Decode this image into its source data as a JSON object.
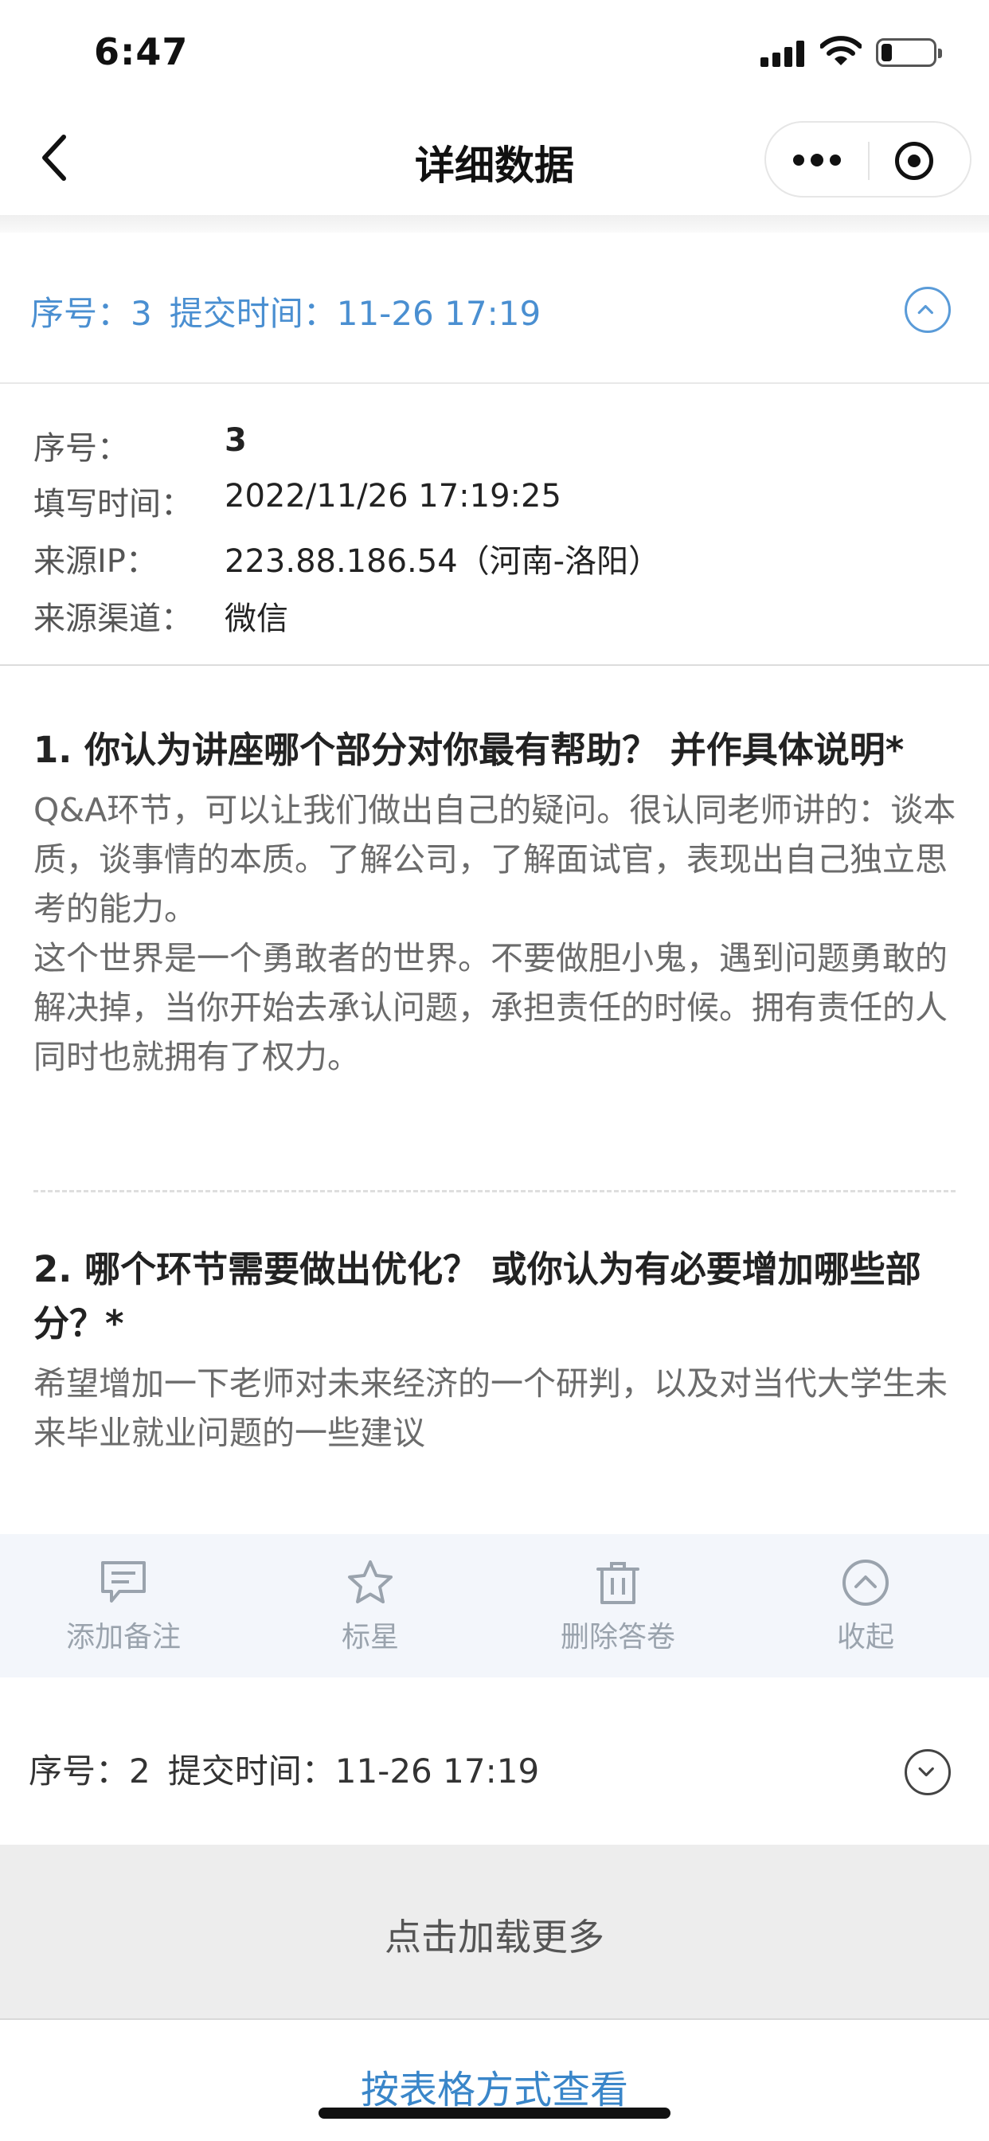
{
  "status_bar": {
    "time": "6:47",
    "battery_level": 0.2
  },
  "nav": {
    "title": "详细数据"
  },
  "current_record": {
    "header": {
      "seq": "序号：3",
      "submit_time": "提交时间：11-26 17:19"
    },
    "meta": [
      {
        "label": "序号：",
        "value": "3"
      },
      {
        "label": "填写时间：",
        "value": "2022/11/26 17:19:25"
      },
      {
        "label": "来源IP：",
        "value": "223.88.186.54（河南-洛阳）"
      },
      {
        "label": "来源渠道：",
        "value": "微信"
      }
    ],
    "questions": [
      {
        "title": "1. 你认为讲座哪个部分对你最有帮助？ 并作具体说明*",
        "answer": "Q&A环节，可以让我们做出自己的疑问。很认同老师讲的：谈本质，谈事情的本质。了解公司，了解面试官，表现出自己独立思考的能力。\n这个世界是一个勇敢者的世界。不要做胆小鬼，遇到问题勇敢的解决掉，当你开始去承认问题，承担责任的时候。拥有责任的人同时也就拥有了权力。"
      },
      {
        "title": "2. 哪个环节需要做出优化？ 或你认为有必要增加哪些部分？*",
        "answer": "希望增加一下老师对未来经济的一个研判，以及对当代大学生未来毕业就业问题的一些建议"
      }
    ]
  },
  "actions": [
    {
      "label": "添加备注",
      "icon": "comment-icon"
    },
    {
      "label": "标星",
      "icon": "star-icon"
    },
    {
      "label": "删除答卷",
      "icon": "trash-icon"
    },
    {
      "label": "收起",
      "icon": "chevron-up-circle-icon"
    }
  ],
  "next_record": {
    "seq": "序号：2",
    "submit_time": "提交时间：11-26 17:19"
  },
  "load_more": "点击加载更多",
  "table_view_link": "按表格方式查看",
  "colors": {
    "accent": "#4a8fd1",
    "action_bar_bg": "#f3f6fb",
    "load_more_bg": "#ededed"
  }
}
